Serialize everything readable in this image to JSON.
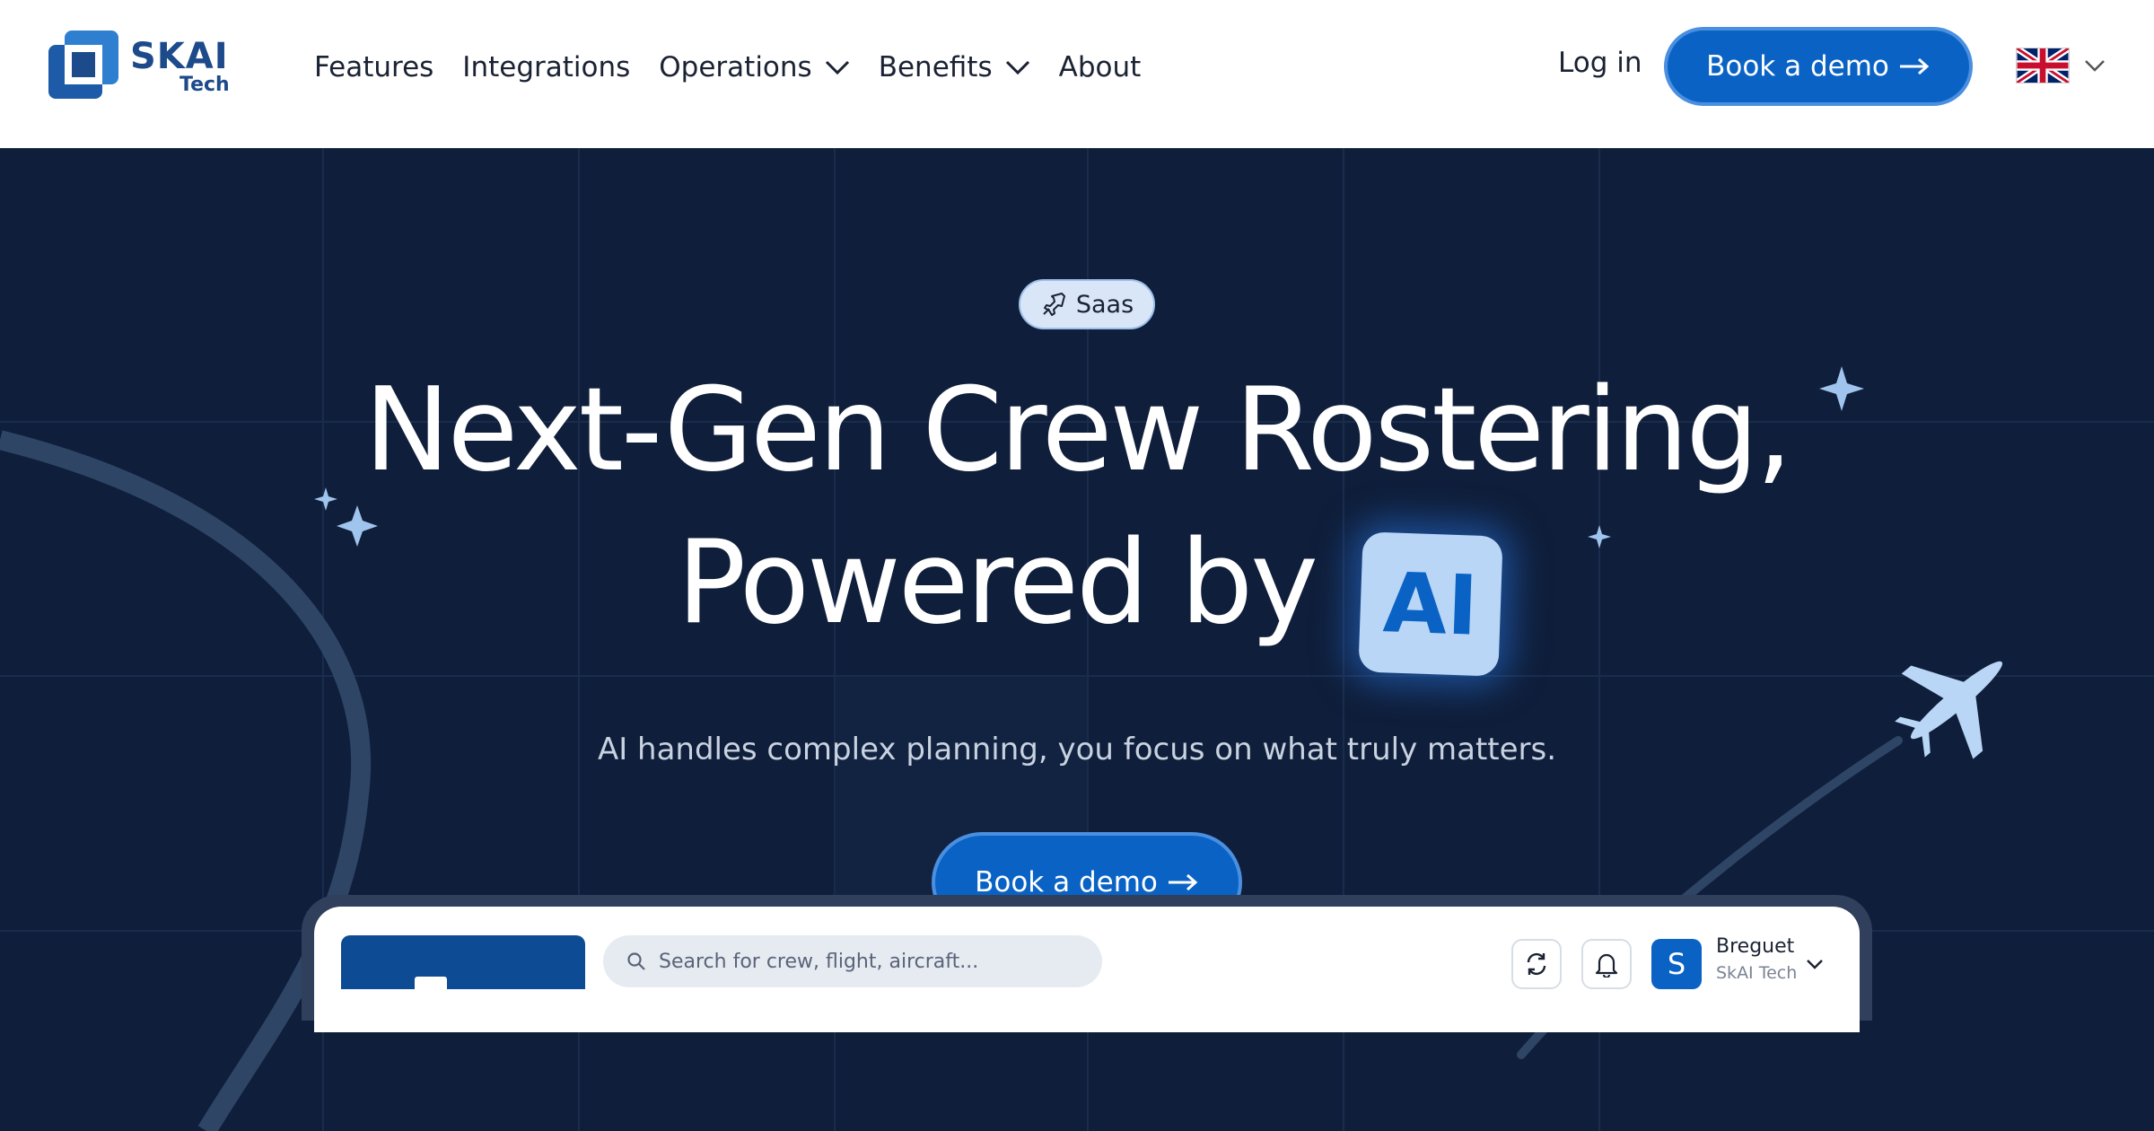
{
  "brand": {
    "name": "SKAI",
    "sub": "Tech"
  },
  "nav": {
    "links": [
      {
        "label": "Features",
        "dropdown": false
      },
      {
        "label": "Integrations",
        "dropdown": false
      },
      {
        "label": "Operations",
        "dropdown": true
      },
      {
        "label": "Benefits",
        "dropdown": true
      },
      {
        "label": "About",
        "dropdown": false
      }
    ],
    "login": "Log in",
    "demo": "Book a demo",
    "language_icon": "uk-flag-icon"
  },
  "hero": {
    "badge": "Saas",
    "title_line1": "Next-Gen Crew Rostering,",
    "title_line2": "Powered by",
    "title_highlight": "AI",
    "subtitle": "AI handles complex planning, you focus on what truly matters.",
    "cta": "Book a demo"
  },
  "preview": {
    "search_placeholder": "Search for crew, flight, aircraft...",
    "avatar_initial": "S",
    "user_name": "Breguet",
    "user_org": "SkAI Tech"
  },
  "colors": {
    "primary": "#0a63c4",
    "hero_bg": "#0f1e3a",
    "brand": "#1d4a8a"
  }
}
